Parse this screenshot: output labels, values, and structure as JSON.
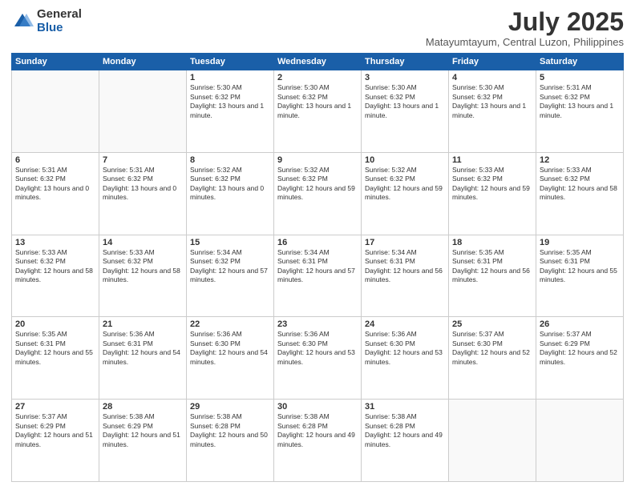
{
  "header": {
    "logo_general": "General",
    "logo_blue": "Blue",
    "title": "July 2025",
    "subtitle": "Matayumtayum, Central Luzon, Philippines"
  },
  "weekdays": [
    "Sunday",
    "Monday",
    "Tuesday",
    "Wednesday",
    "Thursday",
    "Friday",
    "Saturday"
  ],
  "weeks": [
    [
      {
        "day": "",
        "info": ""
      },
      {
        "day": "",
        "info": ""
      },
      {
        "day": "1",
        "info": "Sunrise: 5:30 AM\nSunset: 6:32 PM\nDaylight: 13 hours and 1 minute."
      },
      {
        "day": "2",
        "info": "Sunrise: 5:30 AM\nSunset: 6:32 PM\nDaylight: 13 hours and 1 minute."
      },
      {
        "day": "3",
        "info": "Sunrise: 5:30 AM\nSunset: 6:32 PM\nDaylight: 13 hours and 1 minute."
      },
      {
        "day": "4",
        "info": "Sunrise: 5:30 AM\nSunset: 6:32 PM\nDaylight: 13 hours and 1 minute."
      },
      {
        "day": "5",
        "info": "Sunrise: 5:31 AM\nSunset: 6:32 PM\nDaylight: 13 hours and 1 minute."
      }
    ],
    [
      {
        "day": "6",
        "info": "Sunrise: 5:31 AM\nSunset: 6:32 PM\nDaylight: 13 hours and 0 minutes."
      },
      {
        "day": "7",
        "info": "Sunrise: 5:31 AM\nSunset: 6:32 PM\nDaylight: 13 hours and 0 minutes."
      },
      {
        "day": "8",
        "info": "Sunrise: 5:32 AM\nSunset: 6:32 PM\nDaylight: 13 hours and 0 minutes."
      },
      {
        "day": "9",
        "info": "Sunrise: 5:32 AM\nSunset: 6:32 PM\nDaylight: 12 hours and 59 minutes."
      },
      {
        "day": "10",
        "info": "Sunrise: 5:32 AM\nSunset: 6:32 PM\nDaylight: 12 hours and 59 minutes."
      },
      {
        "day": "11",
        "info": "Sunrise: 5:33 AM\nSunset: 6:32 PM\nDaylight: 12 hours and 59 minutes."
      },
      {
        "day": "12",
        "info": "Sunrise: 5:33 AM\nSunset: 6:32 PM\nDaylight: 12 hours and 58 minutes."
      }
    ],
    [
      {
        "day": "13",
        "info": "Sunrise: 5:33 AM\nSunset: 6:32 PM\nDaylight: 12 hours and 58 minutes."
      },
      {
        "day": "14",
        "info": "Sunrise: 5:33 AM\nSunset: 6:32 PM\nDaylight: 12 hours and 58 minutes."
      },
      {
        "day": "15",
        "info": "Sunrise: 5:34 AM\nSunset: 6:32 PM\nDaylight: 12 hours and 57 minutes."
      },
      {
        "day": "16",
        "info": "Sunrise: 5:34 AM\nSunset: 6:31 PM\nDaylight: 12 hours and 57 minutes."
      },
      {
        "day": "17",
        "info": "Sunrise: 5:34 AM\nSunset: 6:31 PM\nDaylight: 12 hours and 56 minutes."
      },
      {
        "day": "18",
        "info": "Sunrise: 5:35 AM\nSunset: 6:31 PM\nDaylight: 12 hours and 56 minutes."
      },
      {
        "day": "19",
        "info": "Sunrise: 5:35 AM\nSunset: 6:31 PM\nDaylight: 12 hours and 55 minutes."
      }
    ],
    [
      {
        "day": "20",
        "info": "Sunrise: 5:35 AM\nSunset: 6:31 PM\nDaylight: 12 hours and 55 minutes."
      },
      {
        "day": "21",
        "info": "Sunrise: 5:36 AM\nSunset: 6:31 PM\nDaylight: 12 hours and 54 minutes."
      },
      {
        "day": "22",
        "info": "Sunrise: 5:36 AM\nSunset: 6:30 PM\nDaylight: 12 hours and 54 minutes."
      },
      {
        "day": "23",
        "info": "Sunrise: 5:36 AM\nSunset: 6:30 PM\nDaylight: 12 hours and 53 minutes."
      },
      {
        "day": "24",
        "info": "Sunrise: 5:36 AM\nSunset: 6:30 PM\nDaylight: 12 hours and 53 minutes."
      },
      {
        "day": "25",
        "info": "Sunrise: 5:37 AM\nSunset: 6:30 PM\nDaylight: 12 hours and 52 minutes."
      },
      {
        "day": "26",
        "info": "Sunrise: 5:37 AM\nSunset: 6:29 PM\nDaylight: 12 hours and 52 minutes."
      }
    ],
    [
      {
        "day": "27",
        "info": "Sunrise: 5:37 AM\nSunset: 6:29 PM\nDaylight: 12 hours and 51 minutes."
      },
      {
        "day": "28",
        "info": "Sunrise: 5:38 AM\nSunset: 6:29 PM\nDaylight: 12 hours and 51 minutes."
      },
      {
        "day": "29",
        "info": "Sunrise: 5:38 AM\nSunset: 6:28 PM\nDaylight: 12 hours and 50 minutes."
      },
      {
        "day": "30",
        "info": "Sunrise: 5:38 AM\nSunset: 6:28 PM\nDaylight: 12 hours and 49 minutes."
      },
      {
        "day": "31",
        "info": "Sunrise: 5:38 AM\nSunset: 6:28 PM\nDaylight: 12 hours and 49 minutes."
      },
      {
        "day": "",
        "info": ""
      },
      {
        "day": "",
        "info": ""
      }
    ]
  ]
}
